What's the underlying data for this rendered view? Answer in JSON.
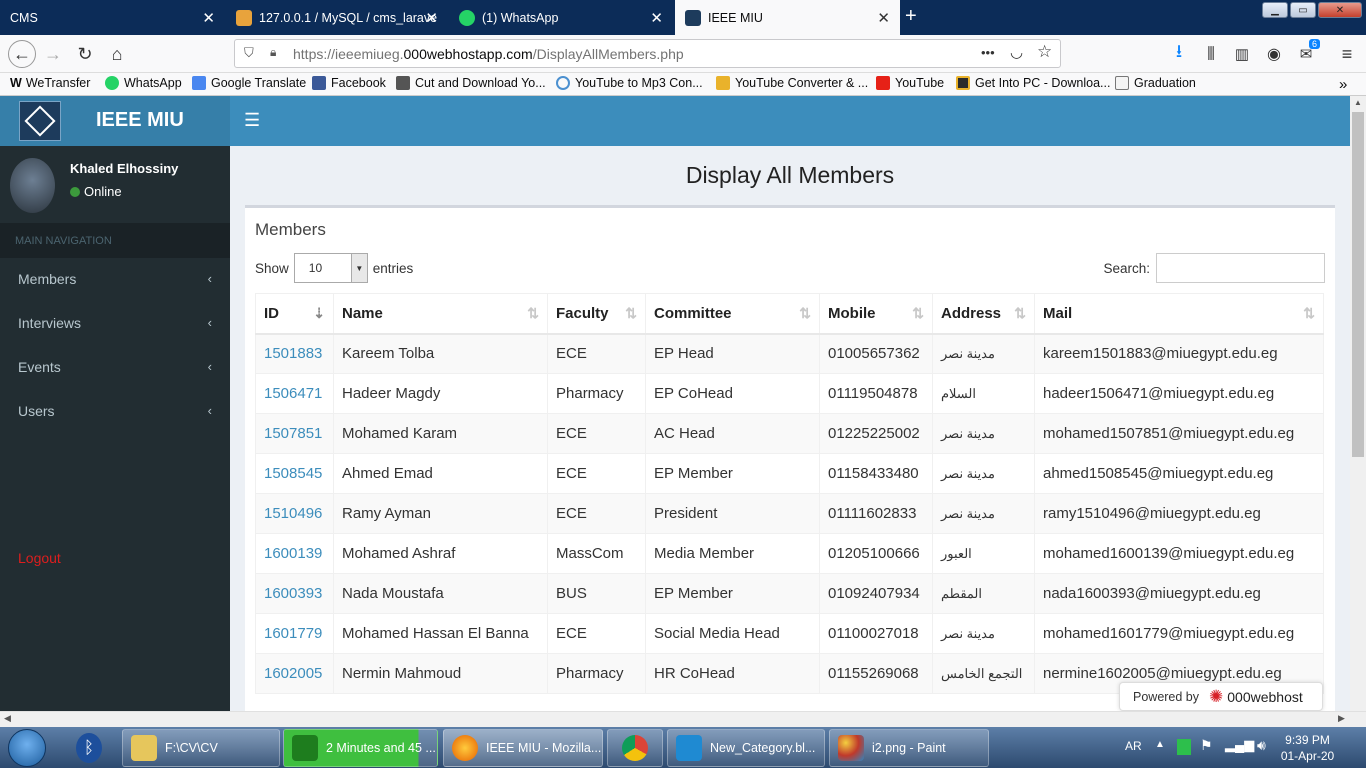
{
  "browser": {
    "tabs": [
      {
        "label": "CMS",
        "active": false
      },
      {
        "label": "127.0.0.1 / MySQL / cms_larave",
        "active": false
      },
      {
        "label": "(1) WhatsApp",
        "active": false
      },
      {
        "label": "IEEE MIU",
        "active": true
      }
    ],
    "new_tab": "+",
    "url_prefix": "https://ieeemiueg.",
    "url_host": "000webhostapp.com",
    "url_path": "/DisplayAllMembers.php",
    "url_menu": "•••",
    "download_badge": "6",
    "bookmarks": [
      "WeTransfer",
      "WhatsApp",
      "Google Translate",
      "Facebook",
      "Cut and Download Yo...",
      "YouTube to Mp3 Con...",
      "YouTube Converter & ...",
      "YouTube",
      "Get Into PC - Downloa...",
      "Graduation"
    ]
  },
  "app": {
    "brand": "IEEE MIU",
    "user": {
      "name": "Khaled Elhossiny",
      "status": "Online"
    },
    "nav_header": "MAIN NAVIGATION",
    "nav_items": [
      {
        "label": "Members"
      },
      {
        "label": "Interviews"
      },
      {
        "label": "Events"
      },
      {
        "label": "Users"
      }
    ],
    "logout": "Logout",
    "page_title": "Display All Members",
    "panel_title": "Members",
    "show_label": "Show",
    "entries_value": "10",
    "entries_label": "entries",
    "search_label": "Search:",
    "columns": [
      "ID",
      "Name",
      "Faculty",
      "Committee",
      "Mobile",
      "Address",
      "Mail"
    ],
    "rows": [
      [
        "1501883",
        "Kareem Tolba",
        "ECE",
        "EP Head",
        "01005657362",
        "مدينة نصر",
        "kareem1501883@miuegypt.edu.eg"
      ],
      [
        "1506471",
        "Hadeer Magdy",
        "Pharmacy",
        "EP CoHead",
        "01119504878",
        "السلام",
        "hadeer1506471@miuegypt.edu.eg"
      ],
      [
        "1507851",
        "Mohamed Karam",
        "ECE",
        "AC Head",
        "01225225002",
        "مدينة نصر",
        "mohamed1507851@miuegypt.edu.eg"
      ],
      [
        "1508545",
        "Ahmed Emad",
        "ECE",
        "EP Member",
        "01158433480",
        "مدينة نصر",
        "ahmed1508545@miuegypt.edu.eg"
      ],
      [
        "1510496",
        "Ramy Ayman",
        "ECE",
        "President",
        "01111602833",
        "مدينة نصر",
        "ramy1510496@miuegypt.edu.eg"
      ],
      [
        "1600139",
        "Mohamed Ashraf",
        "MassCom",
        "Media Member",
        "01205100666",
        "العبور",
        "mohamed1600139@miuegypt.edu.eg"
      ],
      [
        "1600393",
        "Nada Moustafa",
        "BUS",
        "EP Member",
        "01092407934",
        "المقطم",
        "nada1600393@miuegypt.edu.eg"
      ],
      [
        "1601779",
        "Mohamed Hassan El Banna",
        "ECE",
        "Social Media Head",
        "01100027018",
        "مدينة نصر",
        "mohamed1601779@miuegypt.edu.eg"
      ],
      [
        "1602005",
        "Nermin Mahmoud",
        "Pharmacy",
        "HR CoHead",
        "01155269068",
        "التجمع الخامس",
        "nermine1602005@miuegypt.edu.eg"
      ]
    ],
    "powered_label": "Powered by",
    "powered_brand": "000webhost"
  },
  "taskbar": {
    "buttons": [
      "F:\\CV\\CV",
      "2 Minutes and 45 ...",
      "IEEE MIU - Mozilla...",
      "",
      "New_Category.bl...",
      "i2.png - Paint"
    ],
    "lang": "AR",
    "time": "9:39 PM",
    "date": "01-Apr-20"
  },
  "colors": {
    "header": "#3c8dbc",
    "logo_bg": "#367fa9",
    "sidebar": "#222d32",
    "link": "#3c8dbc",
    "logout": "#dd1e1e"
  }
}
